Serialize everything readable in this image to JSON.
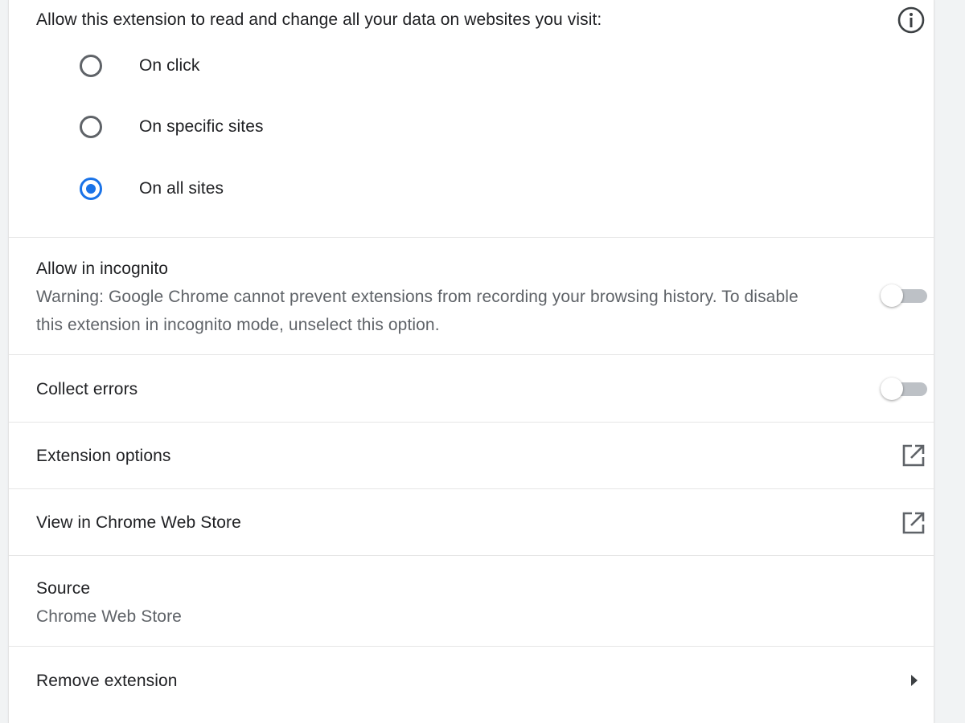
{
  "site_access": {
    "heading": "Allow this extension to read and change all your data on websites you visit:",
    "info_icon": "info-icon",
    "options": [
      {
        "label": "On click",
        "checked": false
      },
      {
        "label": "On specific sites",
        "checked": false
      },
      {
        "label": "On all sites",
        "checked": true
      }
    ]
  },
  "incognito": {
    "title": "Allow in incognito",
    "warning_line1": "Warning: Google Chrome cannot prevent extensions from recording your browsing history. To disable",
    "warning_line2": "this extension in incognito mode, unselect this option.",
    "enabled": false
  },
  "collect_errors": {
    "title": "Collect errors",
    "enabled": false
  },
  "extension_options": {
    "label": "Extension options",
    "icon": "open-in-new-icon"
  },
  "web_store": {
    "label": "View in Chrome Web Store",
    "icon": "open-in-new-icon"
  },
  "source": {
    "title": "Source",
    "value": "Chrome Web Store"
  },
  "remove": {
    "label": "Remove extension",
    "icon": "arrow-right-icon"
  },
  "colors": {
    "accent": "#1a73e8",
    "text_primary": "#202124",
    "text_secondary": "#5f6368",
    "divider": "#e6e6e6",
    "toggle_off_track": "#bdc1c6"
  }
}
